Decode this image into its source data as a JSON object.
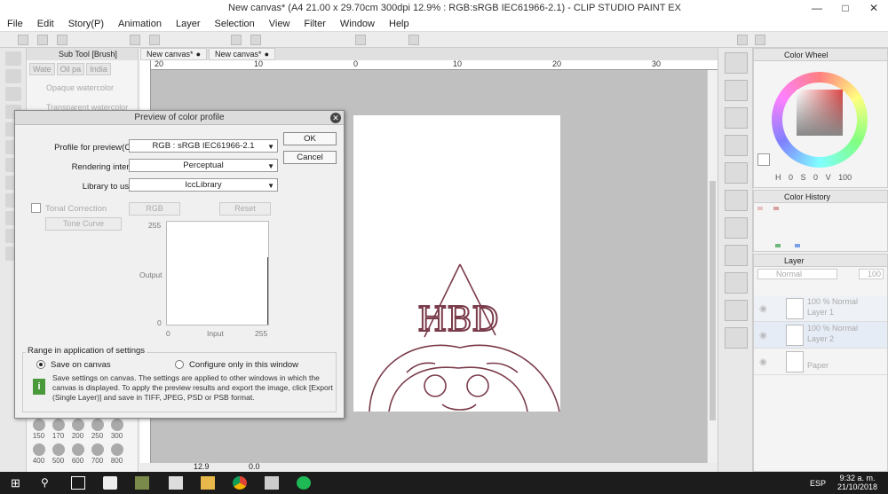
{
  "window": {
    "title": "New canvas* (A4 21.00 x 29.70cm 300dpi 12.9% : RGB:sRGB IEC61966-2.1) - CLIP STUDIO PAINT EX"
  },
  "menu": [
    "File",
    "Edit",
    "Story(P)",
    "Animation",
    "Layer",
    "Selection",
    "View",
    "Filter",
    "Window",
    "Help"
  ],
  "subtool": {
    "header": "Sub Tool [Brush]",
    "tabs": [
      "Wate",
      "Oil pa",
      "India"
    ],
    "brushes": [
      "Opaque watercolor",
      "Transparent watercolor"
    ]
  },
  "canvas_tabs": [
    "New canvas*",
    "New canvas*"
  ],
  "ruler": [
    "20",
    "10",
    "0",
    "10",
    "20",
    "30"
  ],
  "brush_sizes": [
    [
      "150",
      "170",
      "200",
      "250",
      "300"
    ],
    [
      "400",
      "500",
      "600",
      "700",
      "800"
    ]
  ],
  "status": {
    "zoom": "12.9",
    "angle": "0.0"
  },
  "panels": {
    "color_wheel": "Color Wheel",
    "color_history": "Color History",
    "layer": "Layer",
    "hsv": [
      "H 0",
      "S 0",
      "V 100"
    ],
    "blend_mode": "Normal",
    "opacity": "100",
    "layers": [
      {
        "opacity": "100 %",
        "mode": "Normal",
        "name": "Layer 1"
      },
      {
        "opacity": "100 %",
        "mode": "Normal",
        "name": "Layer 2"
      },
      {
        "opacity": "",
        "mode": "",
        "name": "Paper"
      }
    ]
  },
  "dialog": {
    "title": "Preview of color profile",
    "profile_label": "Profile for preview(C):",
    "profile_value": "RGB : sRGB IEC61966-2.1",
    "intent_label": "Rendering intent:",
    "intent_value": "Perceptual",
    "library_label": "Library to use:",
    "library_value": "IccLibrary",
    "ok": "OK",
    "cancel": "Cancel",
    "tonal_label": "Tonal Correction",
    "tonal_mode": "RGB",
    "reset": "Reset",
    "curve": "Tone Curve",
    "graph": {
      "ymax": "255",
      "ymid": "Output",
      "ymin": "0",
      "xmin": "0",
      "xmid": "Input",
      "xmax": "255"
    },
    "range_title": "Range in application of settings",
    "save_canvas": "Save on canvas",
    "configure_only": "Configure only in this window",
    "info": "Save settings on canvas. The settings are applied to other windows in which the canvas is displayed. To apply the preview results and export the image, click [Export (Single Layer)] and save in TIFF, JPEG, PSD or PSB format."
  },
  "canvas_drawing": {
    "text": "HBD",
    "stroke_color": "#7a3b4a"
  },
  "taskbar": {
    "lang": "ESP",
    "time": "9:32 a. m.",
    "date": "21/10/2018"
  }
}
